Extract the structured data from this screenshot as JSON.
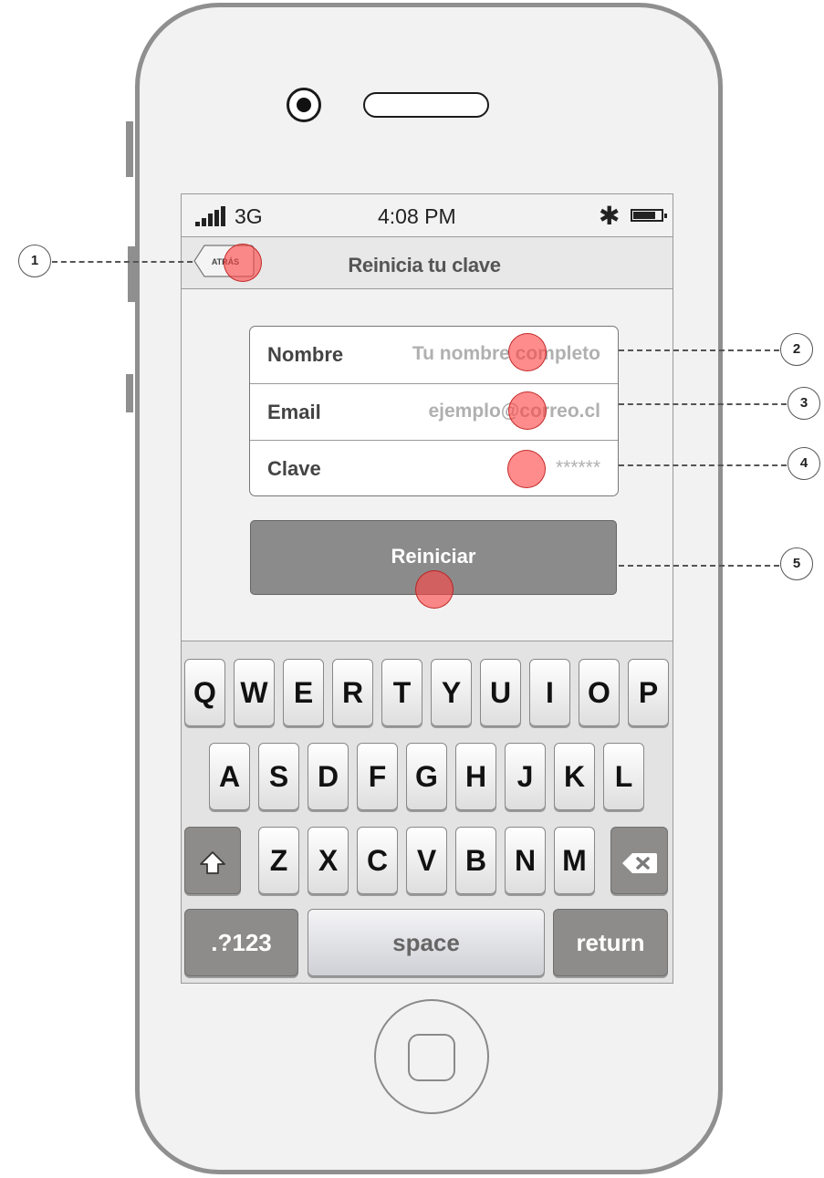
{
  "status_bar": {
    "network": "3G",
    "time": "4:08 PM"
  },
  "nav": {
    "back_label": "ATRÁS",
    "title": "Reinicia tu clave"
  },
  "form": {
    "fields": [
      {
        "label": "Nombre",
        "placeholder": "Tu nombre completo"
      },
      {
        "label": "Email",
        "placeholder": "ejemplo@correo.cl"
      },
      {
        "label": "Clave",
        "placeholder": "******"
      }
    ],
    "submit_label": "Reiniciar"
  },
  "keyboard": {
    "row1": [
      "Q",
      "W",
      "E",
      "R",
      "T",
      "Y",
      "U",
      "I",
      "O",
      "P"
    ],
    "row2": [
      "A",
      "S",
      "D",
      "F",
      "G",
      "H",
      "J",
      "K",
      "L"
    ],
    "row3": [
      "Z",
      "X",
      "C",
      "V",
      "B",
      "N",
      "M"
    ],
    "numbers_label": ".?123",
    "space_label": "space",
    "return_label": "return"
  },
  "callouts": [
    "1",
    "2",
    "3",
    "4",
    "5"
  ],
  "colors": {
    "hotspot": "#ff4646",
    "button": "#8b8b8b"
  }
}
